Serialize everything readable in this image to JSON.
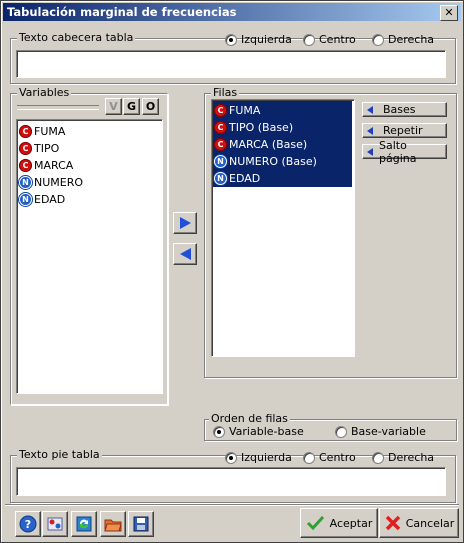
{
  "window": {
    "title": "Tabulación marginal de frecuencias",
    "close_glyph": "✕"
  },
  "header_text": {
    "label": "Texto cabecera tabla",
    "options": [
      "Izquierda",
      "Centro",
      "Derecha"
    ],
    "selected": "Izquierda",
    "value": ""
  },
  "variables": {
    "label": "Variables",
    "tool_buttons": [
      "V",
      "G",
      "O"
    ],
    "items": [
      {
        "type": "C",
        "name": "FUMA"
      },
      {
        "type": "C",
        "name": "TIPO"
      },
      {
        "type": "C",
        "name": "MARCA"
      },
      {
        "type": "N",
        "name": "NUMERO"
      },
      {
        "type": "N",
        "name": "EDAD"
      }
    ]
  },
  "transfer": {
    "add_icon": "arrow-right-icon",
    "remove_icon": "arrow-left-icon"
  },
  "filas": {
    "label": "Filas",
    "items": [
      {
        "type": "C",
        "name": "FUMA"
      },
      {
        "type": "C",
        "name": "TIPO  (Base)"
      },
      {
        "type": "C",
        "name": "MARCA  (Base)"
      },
      {
        "type": "N",
        "name": "NUMERO  (Base)"
      },
      {
        "type": "N",
        "name": "EDAD"
      }
    ],
    "buttons": {
      "bases": "Bases",
      "repetir": "Repetir",
      "salto": "Salto página"
    }
  },
  "row_order": {
    "label": "Orden de filas",
    "options": [
      "Variable-base",
      "Base-variable"
    ],
    "selected": "Variable-base"
  },
  "footer_text": {
    "label": "Texto pie tabla",
    "options": [
      "Izquierda",
      "Centro",
      "Derecha"
    ],
    "selected": "Izquierda",
    "value": ""
  },
  "bottom_bar": {
    "icons": [
      "help-icon",
      "settings-icon",
      "refresh-icon",
      "open-folder-icon",
      "save-icon"
    ],
    "accept": "Aceptar",
    "cancel": "Cancelar"
  },
  "colors": {
    "selection": "#0a246a",
    "categorical_badge": "#d01010",
    "numeric_badge": "#2060c8",
    "title_bar": "#0a246a"
  }
}
